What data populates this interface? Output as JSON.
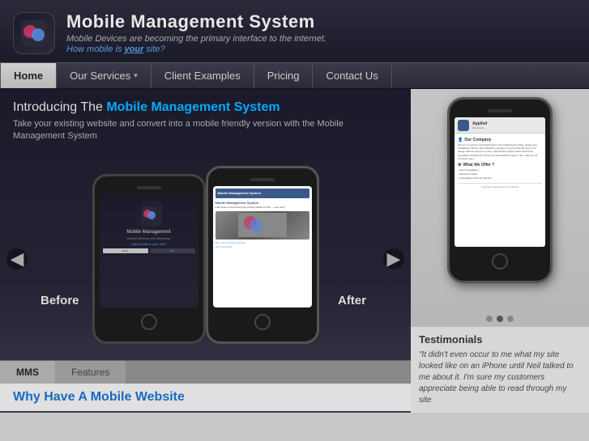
{
  "header": {
    "title": "Mobile Management System",
    "tagline": "Mobile Devices are becoming the primary interface to the internet.",
    "tagline2_prefix": "How mobile is ",
    "tagline2_bold": "your",
    "tagline2_suffix": " site?"
  },
  "nav": {
    "items": [
      {
        "label": "Home",
        "active": true,
        "has_arrow": false
      },
      {
        "label": "Our Services",
        "active": false,
        "has_arrow": true
      },
      {
        "label": "Client Examples",
        "active": false,
        "has_arrow": false
      },
      {
        "label": "Pricing",
        "active": false,
        "has_arrow": false
      },
      {
        "label": "Contact Us",
        "active": false,
        "has_arrow": false
      }
    ]
  },
  "intro": {
    "heading_prefix": "Introducing The ",
    "heading_highlight": "Mobile Management System",
    "body": "Take your existing website and convert into a mobile friendly version with the\nMobile Management System"
  },
  "before_label": "Before",
  "after_label": "After",
  "bottom_tabs": [
    {
      "label": "MMS",
      "active": true
    },
    {
      "label": "Features",
      "active": false
    }
  ],
  "bottom_heading": "Why Have A Mobile Website",
  "right_phone": {
    "logo_text": "Applied",
    "logo_sub": "Pro Sound",
    "section1_title": "Our Company",
    "section1_text": "We are a company of professionals in the audio/visual supply, design and installation industry with collective experience of more than 50 years. Our design staff are second to none, supported by highly trained electronic specialists, dedicated IT personnel and qualified riggers, who make up our complete team.",
    "section2_title": "What We Offer ?",
    "list_items": [
      "- Sound Installation",
      "- Equipment Sales",
      "- Unbeatable Customer Service"
    ],
    "footer": "Copyright 2011 Applied Pro Sound"
  },
  "dot_indicators": [
    {
      "active": false
    },
    {
      "active": true
    },
    {
      "active": false
    }
  ],
  "testimonials": {
    "title": "Testimonials",
    "text": "\"It didn't even occur to me what my site looked like on an iPhone until Neil talked to me about it. I'm sure my customers appreciate being able to read through my site"
  },
  "nav_prev": "◀",
  "nav_next": "▶"
}
